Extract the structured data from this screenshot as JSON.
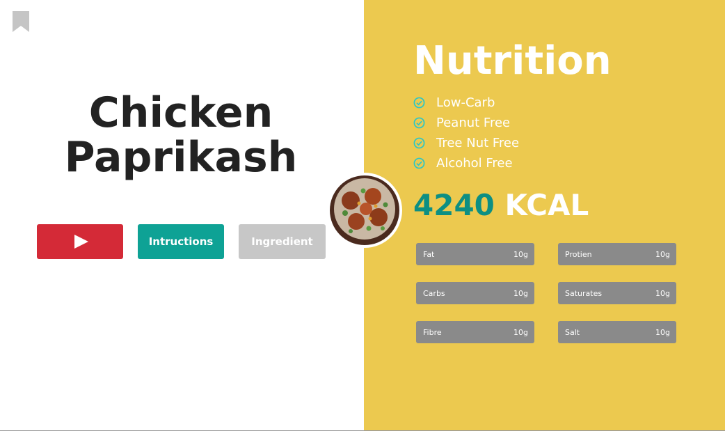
{
  "recipe": {
    "title_line1": "Chicken",
    "title_line2": "Paprikash"
  },
  "buttons": {
    "play_icon": "play-icon",
    "instructions_label": "Intructions",
    "ingredient_label": "Ingredient"
  },
  "nutrition": {
    "heading": "Nutrition",
    "tags": [
      "Low-Carb",
      "Peanut Free",
      "Tree Nut Free",
      "Alcohol Free"
    ],
    "kcal_value": "4240",
    "kcal_unit": "KCAL",
    "facts": [
      {
        "label": "Fat",
        "value": "10g"
      },
      {
        "label": "Protien",
        "value": "10g"
      },
      {
        "label": "Carbs",
        "value": "10g"
      },
      {
        "label": "Saturates",
        "value": "10g"
      },
      {
        "label": "Fibre",
        "value": "10g"
      },
      {
        "label": "Salt",
        "value": "10g"
      }
    ]
  },
  "colors": {
    "panel_yellow": "#ecc94f",
    "play_red": "#d42a37",
    "instructions_teal": "#0ea295",
    "ingredient_grey": "#c7c7c7",
    "kcal_teal": "#0d8f83",
    "fact_grey": "#8a8a8a",
    "check_cyan": "#2cc6c6"
  },
  "icons": {
    "bookmark": "bookmark-icon",
    "check": "check-circle-icon"
  }
}
